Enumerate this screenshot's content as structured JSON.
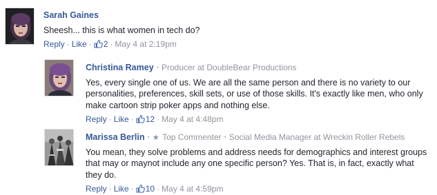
{
  "comments": [
    {
      "name": "Sarah Gaines",
      "subtitle": "",
      "text": "Sheesh... this is what women in tech do?",
      "reply_label": "Reply",
      "like_label": "Like",
      "like_count": "2",
      "timestamp": "May 4 at 2:19pm"
    },
    {
      "name": "Christina Ramey",
      "subtitle": "Producer at DoubleBear Productions",
      "text": "Yes, every single one of us. We are all the same person and there is no variety to our personalities, preferences, skill sets, or use of those skills. It's exactly like men, who only make cartoon strip poker apps and nothing else.",
      "reply_label": "Reply",
      "like_label": "Like",
      "like_count": "12",
      "timestamp": "May 4 at 4:48pm"
    },
    {
      "name": "Marissa Berlin",
      "badge": "Top Commenter",
      "subtitle": "Social Media Manager at Wreckin Roller Rebels",
      "text": "You mean, they solve problems and address needs for demographics and interest groups that may or maynot include any one specific person? Yes. That is, in fact, exactly what they do.",
      "reply_label": "Reply",
      "like_label": "Like",
      "like_count": "10",
      "timestamp": "May 4 at 4:59pm"
    }
  ],
  "icons": {
    "like": "thumbs-up-icon",
    "star": "star-icon"
  },
  "colors": {
    "link": "#365899",
    "meta": "#90949c",
    "text": "#1d2129"
  }
}
